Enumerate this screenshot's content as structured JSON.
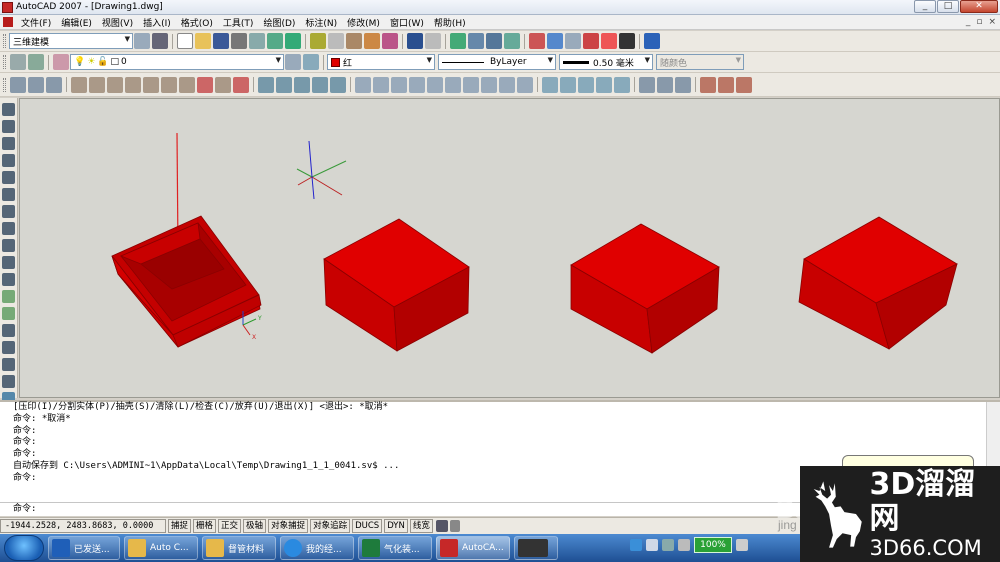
{
  "window": {
    "title": "AutoCAD 2007 - [Drawing1.dwg]",
    "controls": [
      "_",
      "□",
      "✕"
    ]
  },
  "menu": {
    "items": [
      "文件(F)",
      "编辑(E)",
      "视图(V)",
      "插入(I)",
      "格式(O)",
      "工具(T)",
      "绘图(D)",
      "标注(N)",
      "修改(M)",
      "窗口(W)",
      "帮助(H)"
    ]
  },
  "toolbar": {
    "workspace": "三维建模",
    "layer": "0",
    "color": "红",
    "linetype": "ByLayer",
    "lineweight": "0.50 毫米",
    "plotstyle": "随颜色"
  },
  "command_window": {
    "history": [
      "[压印(I)/分割实体(P)/抽壳(S)/清除(L)/检查(C)/放弃(U)/退出(X)] <退出>: *取消*",
      "命令: *取消*",
      "命令:",
      "命令:",
      "命令:",
      "自动保存到 C:\\Users\\ADMINI~1\\AppData\\Local\\Temp\\Drawing1_1_1_0041.sv$ ...",
      "命令:"
    ],
    "prompt": "命令:"
  },
  "statusbar": {
    "coords": "-1944.2528, 2483.8683, 0.0000",
    "toggles": [
      "捕捉",
      "栅格",
      "正交",
      "极轴",
      "对象捕捉",
      "对象追踪",
      "DUCS",
      "DYN",
      "线宽"
    ]
  },
  "taskbar": {
    "tasks": [
      "已发送...",
      "Auto C...",
      "督管材料",
      "我的经...",
      "气化装...",
      "AutoCA..."
    ],
    "battery": "100%"
  },
  "watermark": {
    "big": "3D溜溜网",
    "small": "3D66.COM"
  },
  "colors": {
    "solid": "#e00000",
    "viewport_bg": "#d6d6d0"
  }
}
